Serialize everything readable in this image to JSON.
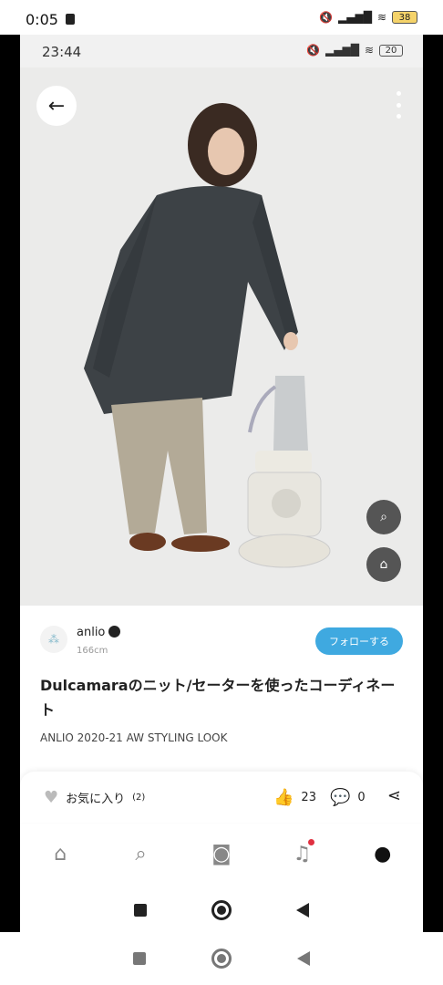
{
  "outer_status": {
    "time": "0:05",
    "battery": "38"
  },
  "inner_status": {
    "time": "23:44",
    "battery": "20"
  },
  "photo": {
    "icons": [
      "back-arrow-icon",
      "more-vertical-icon",
      "zoom-search-icon",
      "tag-icon"
    ]
  },
  "profile": {
    "username": "anlio",
    "height": "166cm",
    "follow_label": "フォローする"
  },
  "post": {
    "title": "Dulcamaraのニット/セーターを使ったコーディネート",
    "subtitle": "ANLIO 2020-21 AW STYLING LOOK"
  },
  "actions": {
    "favorite_label": "お気に入り",
    "favorite_count": "(2)",
    "likes": "23",
    "comments": "0"
  },
  "bottom_nav": {
    "items": [
      "home-icon",
      "search-icon",
      "camera-icon",
      "bell-icon",
      "profile-icon"
    ]
  },
  "colors": {
    "accent": "#3fa9e0",
    "notification": "#e03040"
  }
}
